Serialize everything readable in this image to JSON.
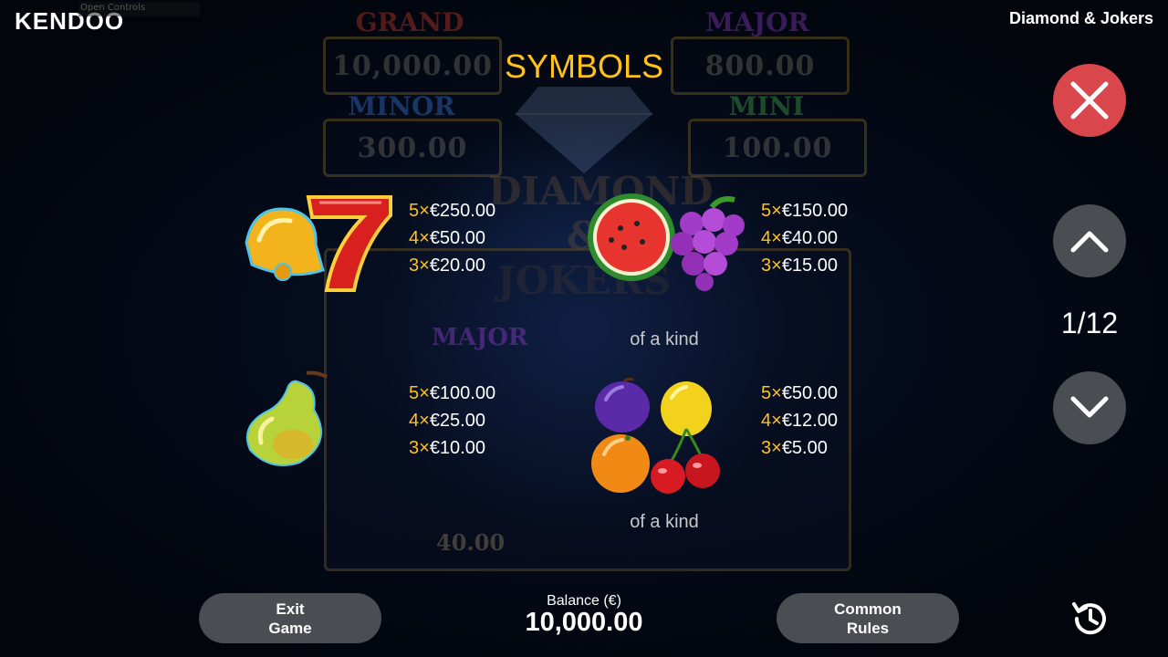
{
  "header": {
    "brand_logo": "KENDOO",
    "open_controls": "Open Controls",
    "game_title": "Diamond & Jokers"
  },
  "background": {
    "jackpots": [
      {
        "title": "GRAND",
        "value": "10,000.00",
        "color": "#c8322a"
      },
      {
        "title": "MAJOR",
        "value": "800.00",
        "color": "#8b3cc8"
      },
      {
        "title": "MINOR",
        "value": "300.00",
        "color": "#2e6cc8"
      },
      {
        "title": "MINI",
        "value": "100.00",
        "color": "#3aa040"
      }
    ],
    "logo_text": "DIAMOND & JOKERS",
    "reel_label_major": "MAJOR",
    "reel_value": "40.00"
  },
  "paytable": {
    "title": "SYMBOLS",
    "of_a_kind": "of a kind",
    "symbols": [
      {
        "icons": [
          "bell-icon",
          "seven-icon"
        ],
        "pays": [
          {
            "count": "5×",
            "value": "€250.00"
          },
          {
            "count": "4×",
            "value": "€50.00"
          },
          {
            "count": "3×",
            "value": "€20.00"
          }
        ]
      },
      {
        "icons": [
          "watermelon-icon",
          "grapes-icon"
        ],
        "pays": [
          {
            "count": "5×",
            "value": "€150.00"
          },
          {
            "count": "4×",
            "value": "€40.00"
          },
          {
            "count": "3×",
            "value": "€15.00"
          }
        ]
      },
      {
        "icons": [
          "pear-icon"
        ],
        "pays": [
          {
            "count": "5×",
            "value": "€100.00"
          },
          {
            "count": "4×",
            "value": "€25.00"
          },
          {
            "count": "3×",
            "value": "€10.00"
          }
        ]
      },
      {
        "icons": [
          "plum-icon",
          "lemon-icon",
          "orange-icon",
          "cherries-icon"
        ],
        "pays": [
          {
            "count": "5×",
            "value": "€50.00"
          },
          {
            "count": "4×",
            "value": "€12.00"
          },
          {
            "count": "3×",
            "value": "€5.00"
          }
        ]
      }
    ]
  },
  "controls": {
    "close_icon": "close-icon",
    "up_icon": "chevron-up-icon",
    "down_icon": "chevron-down-icon",
    "page": "1/12",
    "exit_label": "Exit\nGame",
    "common_rules_label": "Common\nRules",
    "balance_label": "Balance (€)",
    "balance_value": "10,000.00",
    "history_icon": "history-icon"
  },
  "colors": {
    "accent": "#ffc21a",
    "close": "#d9474d",
    "button": "#4a4d52"
  }
}
